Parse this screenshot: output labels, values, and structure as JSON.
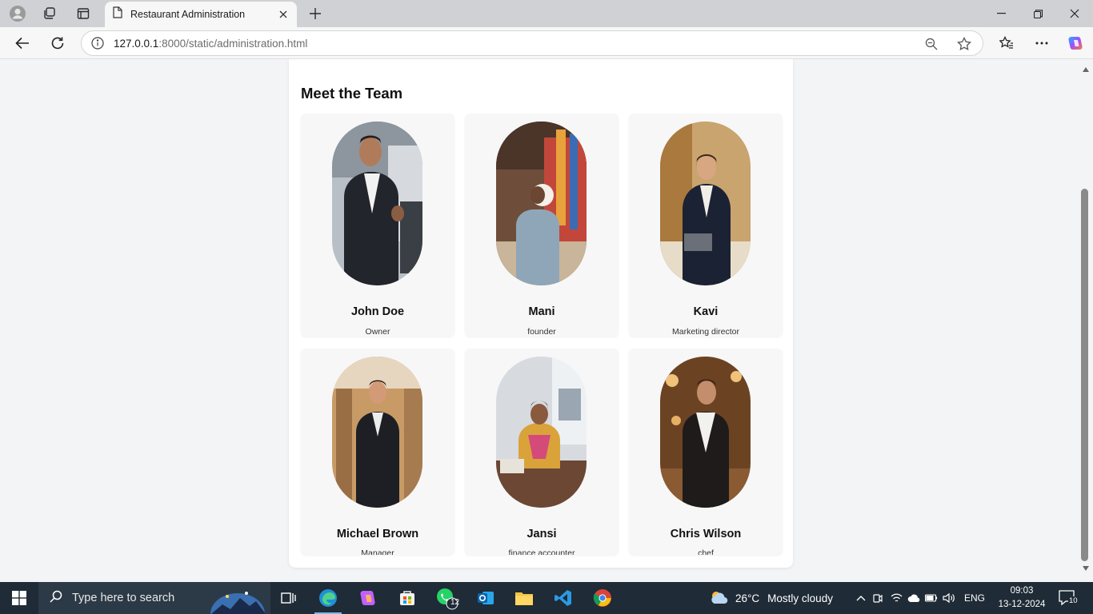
{
  "browser": {
    "tab_title": "Restaurant Administration",
    "url_host": "127.0.0.1",
    "url_rest": ":8000/static/administration.html"
  },
  "page": {
    "heading": "Meet the Team",
    "team": [
      {
        "name": "John Doe",
        "role": "Owner"
      },
      {
        "name": "Mani",
        "role": "founder"
      },
      {
        "name": "Kavi",
        "role": "Marketing director"
      },
      {
        "name": "Michael Brown",
        "role": "Manager"
      },
      {
        "name": "Jansi",
        "role": "finance accounter"
      },
      {
        "name": "Chris Wilson",
        "role": "chef"
      }
    ]
  },
  "taskbar": {
    "search_placeholder": "Type here to search",
    "whatsapp_badge": "12",
    "weather_temp": "26°C",
    "weather_text": "Mostly cloudy",
    "language": "ENG",
    "time": "09:03",
    "date": "13-12-2024",
    "notification_count": "10"
  },
  "colors": {
    "accent": "#0078d4",
    "taskbar": "#1f2b36"
  }
}
